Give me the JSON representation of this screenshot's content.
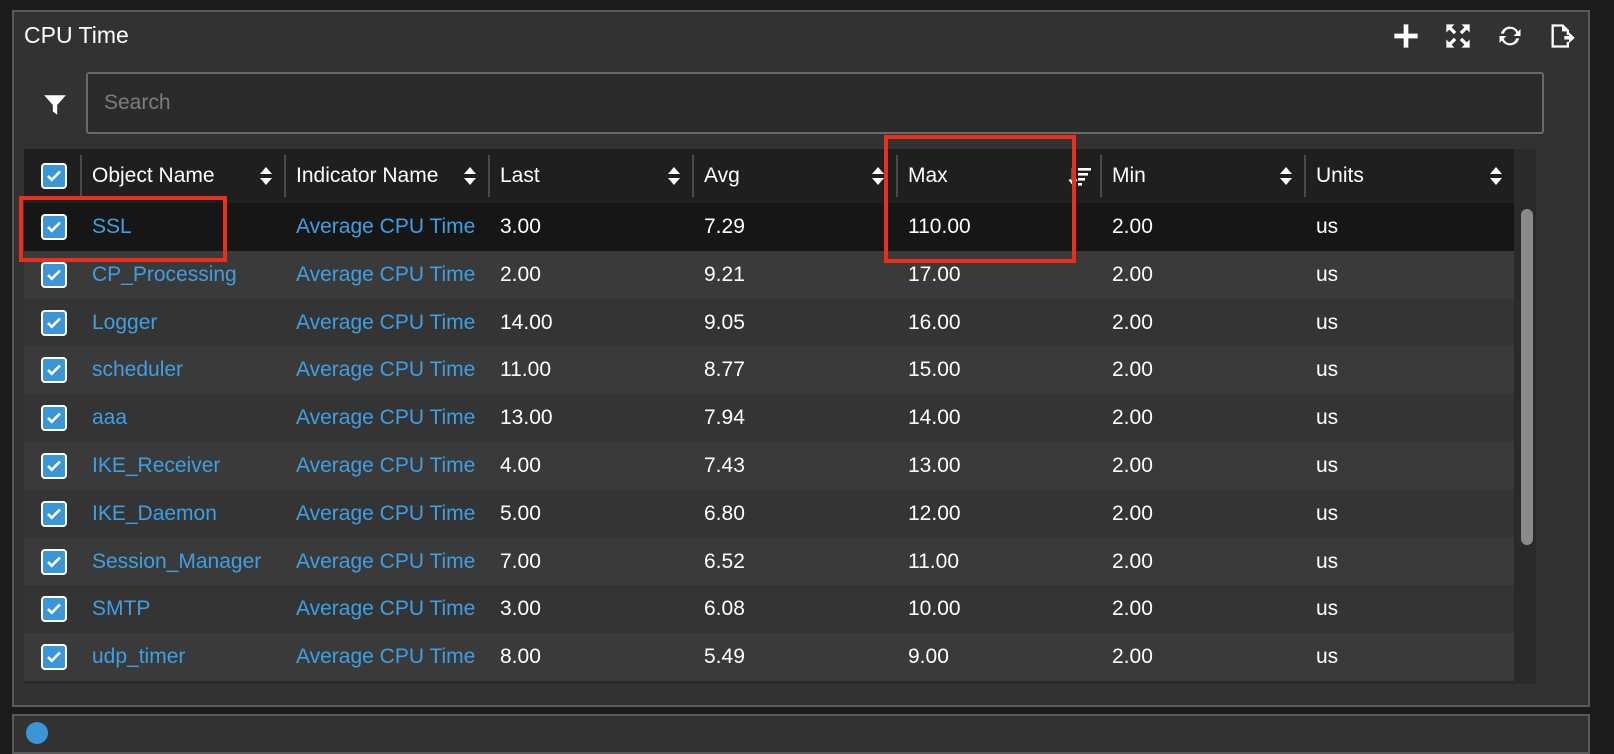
{
  "panel": {
    "title": "CPU Time",
    "actions": [
      {
        "icon": "plus-icon",
        "name": "add-button"
      },
      {
        "icon": "expand-icon",
        "name": "expand-button"
      },
      {
        "icon": "refresh-icon",
        "name": "refresh-button"
      },
      {
        "icon": "export-icon",
        "name": "export-button"
      }
    ]
  },
  "search": {
    "placeholder": "Search",
    "value": ""
  },
  "table": {
    "columns": [
      {
        "key": "object",
        "label": "Object Name",
        "sort": "sortable"
      },
      {
        "key": "indicator",
        "label": "Indicator Name",
        "sort": "sortable"
      },
      {
        "key": "last",
        "label": "Last",
        "sort": "sortable"
      },
      {
        "key": "avg",
        "label": "Avg",
        "sort": "sortable"
      },
      {
        "key": "max",
        "label": "Max",
        "sort": "descending"
      },
      {
        "key": "min",
        "label": "Min",
        "sort": "sortable"
      },
      {
        "key": "units",
        "label": "Units",
        "sort": "sortable"
      }
    ],
    "select_all_checked": true,
    "rows": [
      {
        "checked": true,
        "object": "SSL",
        "indicator": "Average CPU Time",
        "last": "3.00",
        "avg": "7.29",
        "max": "110.00",
        "min": "2.00",
        "units": "us"
      },
      {
        "checked": true,
        "object": "CP_Processing",
        "indicator": "Average CPU Time",
        "last": "2.00",
        "avg": "9.21",
        "max": "17.00",
        "min": "2.00",
        "units": "us"
      },
      {
        "checked": true,
        "object": "Logger",
        "indicator": "Average CPU Time",
        "last": "14.00",
        "avg": "9.05",
        "max": "16.00",
        "min": "2.00",
        "units": "us"
      },
      {
        "checked": true,
        "object": "scheduler",
        "indicator": "Average CPU Time",
        "last": "11.00",
        "avg": "8.77",
        "max": "15.00",
        "min": "2.00",
        "units": "us"
      },
      {
        "checked": true,
        "object": "aaa",
        "indicator": "Average CPU Time",
        "last": "13.00",
        "avg": "7.94",
        "max": "14.00",
        "min": "2.00",
        "units": "us"
      },
      {
        "checked": true,
        "object": "IKE_Receiver",
        "indicator": "Average CPU Time",
        "last": "4.00",
        "avg": "7.43",
        "max": "13.00",
        "min": "2.00",
        "units": "us"
      },
      {
        "checked": true,
        "object": "IKE_Daemon",
        "indicator": "Average CPU Time",
        "last": "5.00",
        "avg": "6.80",
        "max": "12.00",
        "min": "2.00",
        "units": "us"
      },
      {
        "checked": true,
        "object": "Session_Manager",
        "indicator": "Average CPU Time",
        "last": "7.00",
        "avg": "6.52",
        "max": "11.00",
        "min": "2.00",
        "units": "us"
      },
      {
        "checked": true,
        "object": "SMTP",
        "indicator": "Average CPU Time",
        "last": "3.00",
        "avg": "6.08",
        "max": "10.00",
        "min": "2.00",
        "units": "us"
      },
      {
        "checked": true,
        "object": "udp_timer",
        "indicator": "Average CPU Time",
        "last": "8.00",
        "avg": "5.49",
        "max": "9.00",
        "min": "2.00",
        "units": "us"
      }
    ]
  },
  "colors": {
    "link": "#3ea0e4",
    "checkbox": "#3b96d8",
    "highlight": "#e8301c",
    "panel": "#323232",
    "header": "#1f1f1f"
  }
}
